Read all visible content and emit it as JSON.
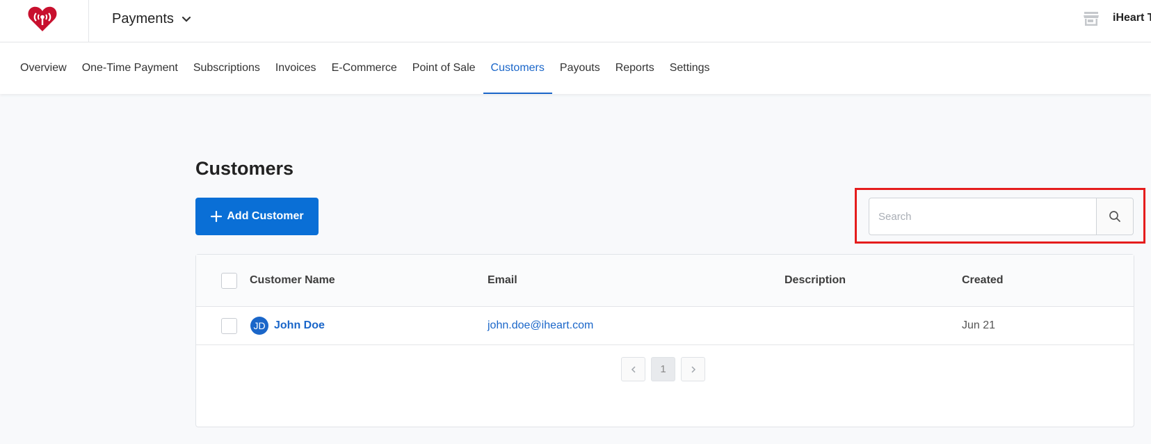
{
  "header": {
    "app_title": "Payments",
    "account_name": "iHeart T",
    "brand_color": "#c8102e"
  },
  "nav": {
    "tabs": [
      {
        "label": "Overview",
        "active": false
      },
      {
        "label": "One-Time Payment",
        "active": false
      },
      {
        "label": "Subscriptions",
        "active": false
      },
      {
        "label": "Invoices",
        "active": false
      },
      {
        "label": "E-Commerce",
        "active": false
      },
      {
        "label": "Point of Sale",
        "active": false
      },
      {
        "label": "Customers",
        "active": true
      },
      {
        "label": "Payouts",
        "active": false
      },
      {
        "label": "Reports",
        "active": false
      },
      {
        "label": "Settings",
        "active": false
      }
    ]
  },
  "main": {
    "title": "Customers",
    "add_button_label": "Add Customer",
    "search": {
      "placeholder": "Search",
      "value": ""
    }
  },
  "table": {
    "columns": {
      "name": "Customer Name",
      "email": "Email",
      "description": "Description",
      "created": "Created"
    },
    "rows": [
      {
        "initials": "JD",
        "name": "John Doe",
        "email": "john.doe@iheart.com",
        "description": "",
        "created": "Jun 21"
      }
    ]
  },
  "pagination": {
    "current_page": "1",
    "prev_icon": "chevron-left-icon",
    "next_icon": "chevron-right-icon"
  },
  "colors": {
    "accent": "#0a6fd6",
    "link": "#1a66c9",
    "highlight": "#e51d1d"
  }
}
